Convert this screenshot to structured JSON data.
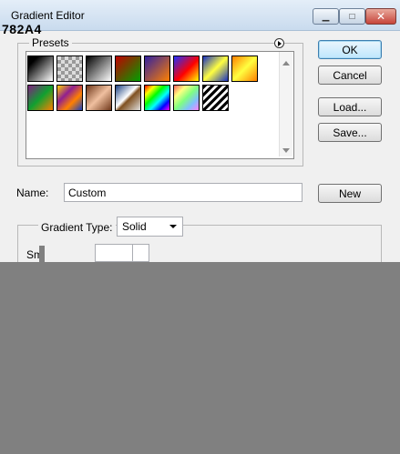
{
  "window": {
    "title": "Gradient Editor",
    "overlay_text": "782A4",
    "controls": {
      "minimize": "▁",
      "maximize": "□",
      "close": "✕"
    }
  },
  "presets": {
    "label": "Presets",
    "swatches": [
      {
        "name": "black-white",
        "css": "linear-gradient(135deg,#000 0%,#000 20%,#fff 100%)"
      },
      {
        "name": "transparent-checker",
        "css": "repeating-conic-gradient(#999 0% 25%, #ddd 0% 50%) 0 0/8px 8px"
      },
      {
        "name": "black-to-white",
        "css": "linear-gradient(135deg,#000,#fff)"
      },
      {
        "name": "red-green",
        "css": "linear-gradient(135deg,#c00000,#00a000)"
      },
      {
        "name": "violet-orange",
        "css": "linear-gradient(135deg,#3020a0,#ff8000)"
      },
      {
        "name": "blue-red-yellow",
        "css": "linear-gradient(135deg,#2030ff,#ff0000 55%,#ffff00)"
      },
      {
        "name": "blue-yellow-blue",
        "css": "linear-gradient(135deg,#1830c0,#ffff40 50%,#1830c0)"
      },
      {
        "name": "orange-yellow-orange",
        "css": "linear-gradient(135deg,#ff8000,#ffff40 50%,#ff8000)"
      },
      {
        "name": "violet-green-orange",
        "css": "linear-gradient(135deg,#802080,#10a030 50%,#ff8000)"
      },
      {
        "name": "yellow-violet-orange-blue",
        "css": "linear-gradient(135deg,#ffd000,#902090 35%,#ff8000 65%,#1840c0)"
      },
      {
        "name": "copper",
        "css": "linear-gradient(135deg,#70381a,#f0c0a0 50%,#70381a)"
      },
      {
        "name": "chrome",
        "css": "linear-gradient(135deg,#1a4080,#ffffff 45%,#805020 55%,#e0e0e0)"
      },
      {
        "name": "spectrum",
        "css": "linear-gradient(135deg,#ff0000,#ffff00,#00ff00,#00ffff,#0000ff,#ff00ff)"
      },
      {
        "name": "transparent-rainbow",
        "css": "linear-gradient(135deg,#ff6060,#ffff80,#80ff80,#80c0ff,#ff80ff)"
      },
      {
        "name": "transparent-stripes",
        "css": "repeating-linear-gradient(135deg,#000 0 3px,#fff 3px 6px)"
      }
    ]
  },
  "buttons": {
    "ok": "OK",
    "cancel": "Cancel",
    "load": "Load...",
    "save": "Save...",
    "new": "New"
  },
  "name_field": {
    "label": "Name:",
    "value": "Custom"
  },
  "gradient_type": {
    "label": "Gradient Type:",
    "value": "Solid"
  },
  "smoothness": {
    "label": "Smoothness:"
  }
}
